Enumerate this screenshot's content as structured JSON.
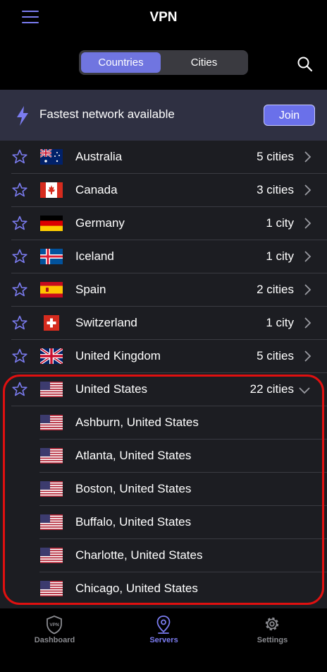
{
  "header": {
    "title": "VPN"
  },
  "segment": {
    "countries": "Countries",
    "cities": "Cities"
  },
  "banner": {
    "text": "Fastest network available",
    "join": "Join"
  },
  "countries": [
    {
      "name": "Australia",
      "count": "5 cities",
      "flag": "australia"
    },
    {
      "name": "Canada",
      "count": "3 cities",
      "flag": "canada"
    },
    {
      "name": "Germany",
      "count": "1 city",
      "flag": "germany"
    },
    {
      "name": "Iceland",
      "count": "1 city",
      "flag": "iceland"
    },
    {
      "name": "Spain",
      "count": "2 cities",
      "flag": "spain"
    },
    {
      "name": "Switzerland",
      "count": "1 city",
      "flag": "switzerland"
    },
    {
      "name": "United Kingdom",
      "count": "5 cities",
      "flag": "united-kingdom"
    },
    {
      "name": "United States",
      "count": "22 cities",
      "flag": "united-states",
      "expanded": true
    }
  ],
  "cities": [
    {
      "name": "Ashburn, United States"
    },
    {
      "name": "Atlanta, United States"
    },
    {
      "name": "Boston, United States"
    },
    {
      "name": "Buffalo, United States"
    },
    {
      "name": "Charlotte, United States"
    },
    {
      "name": "Chicago, United States"
    }
  ],
  "tabs": {
    "dashboard": "Dashboard",
    "servers": "Servers",
    "settings": "Settings",
    "vpn_badge": "VPN"
  },
  "colors": {
    "accent": "#7075e0",
    "highlight": "#e01010",
    "background": "#1c1d22"
  }
}
